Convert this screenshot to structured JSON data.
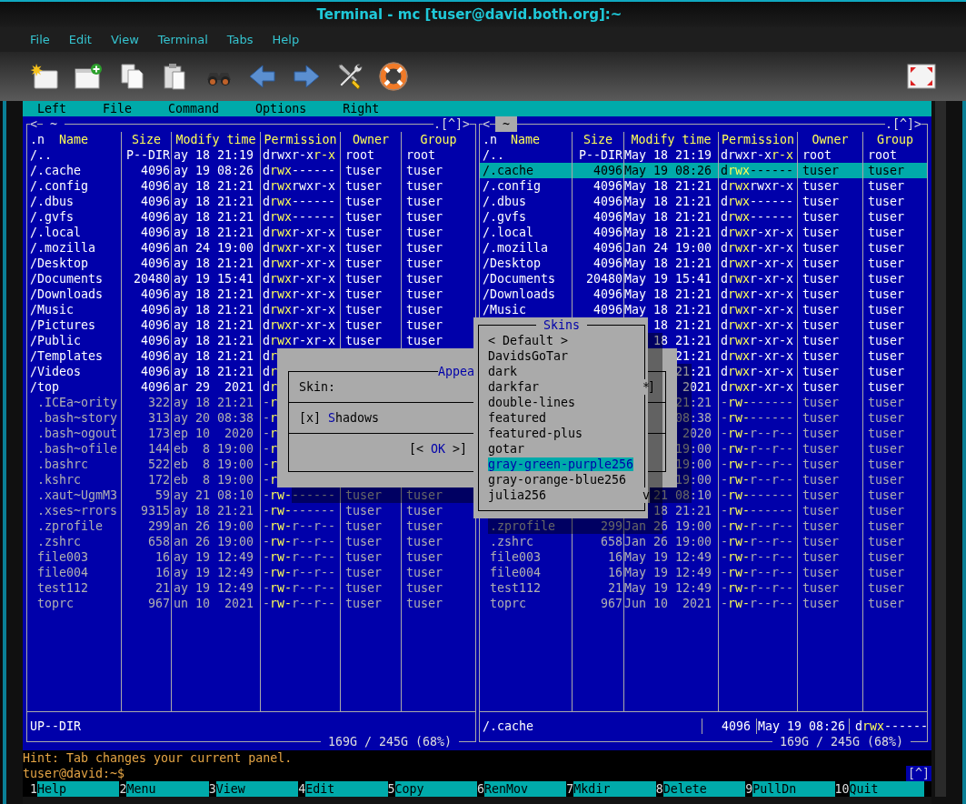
{
  "window": {
    "title": "Terminal - mc [tuser@david.both.org]:~"
  },
  "menu": [
    "File",
    "Edit",
    "View",
    "Terminal",
    "Tabs",
    "Help"
  ],
  "mc_menu": [
    "Left",
    "File",
    "Command",
    "Options",
    "Right"
  ],
  "panels": [
    {
      "history": "<",
      "path": "~",
      "path_selected": false,
      "hotlist": ".[^]>",
      "sort_mark": ".n",
      "columns": [
        "Name",
        "Size",
        "Modify time",
        "Permission",
        "Owner",
        "Group"
      ],
      "rows": [
        {
          "kind": "dir",
          "name": "/..",
          "size": "P--DIR",
          "modified": "ay 18 21:19",
          "permission": "drwxr-xr-x",
          "is_owner": false,
          "owner": "root",
          "group": "root",
          "selected": false
        },
        {
          "kind": "dir",
          "name": "/.cache",
          "size": "4096",
          "modified": "ay 19 08:26",
          "permission": "drwx------",
          "is_owner": true,
          "owner": "tuser",
          "group": "tuser",
          "selected": false
        },
        {
          "kind": "dir",
          "name": "/.config",
          "size": "4096",
          "modified": "ay 18 21:21",
          "permission": "drwxrwxr-x",
          "is_owner": true,
          "owner": "tuser",
          "group": "tuser",
          "selected": false
        },
        {
          "kind": "dir",
          "name": "/.dbus",
          "size": "4096",
          "modified": "ay 18 21:21",
          "permission": "drwx------",
          "is_owner": true,
          "owner": "tuser",
          "group": "tuser",
          "selected": false
        },
        {
          "kind": "dir",
          "name": "/.gvfs",
          "size": "4096",
          "modified": "ay 18 21:21",
          "permission": "drwx------",
          "is_owner": true,
          "owner": "tuser",
          "group": "tuser",
          "selected": false
        },
        {
          "kind": "dir",
          "name": "/.local",
          "size": "4096",
          "modified": "ay 18 21:21",
          "permission": "drwxr-xr-x",
          "is_owner": true,
          "owner": "tuser",
          "group": "tuser",
          "selected": false
        },
        {
          "kind": "dir",
          "name": "/.mozilla",
          "size": "4096",
          "modified": "an 24 19:00",
          "permission": "drwxr-xr-x",
          "is_owner": true,
          "owner": "tuser",
          "group": "tuser",
          "selected": false
        },
        {
          "kind": "dir",
          "name": "/Desktop",
          "size": "4096",
          "modified": "ay 18 21:21",
          "permission": "drwxr-xr-x",
          "is_owner": true,
          "owner": "tuser",
          "group": "tuser",
          "selected": false
        },
        {
          "kind": "dir",
          "name": "/Documents",
          "size": "20480",
          "modified": "ay 19 15:41",
          "permission": "drwxr-xr-x",
          "is_owner": true,
          "owner": "tuser",
          "group": "tuser",
          "selected": false
        },
        {
          "kind": "dir",
          "name": "/Downloads",
          "size": "4096",
          "modified": "ay 18 21:21",
          "permission": "drwxr-xr-x",
          "is_owner": true,
          "owner": "tuser",
          "group": "tuser",
          "selected": false
        },
        {
          "kind": "dir",
          "name": "/Music",
          "size": "4096",
          "modified": "ay 18 21:21",
          "permission": "drwxr-xr-x",
          "is_owner": true,
          "owner": "tuser",
          "group": "tuser",
          "selected": false
        },
        {
          "kind": "dir",
          "name": "/Pictures",
          "size": "4096",
          "modified": "ay 18 21:21",
          "permission": "drwxr-xr-x",
          "is_owner": true,
          "owner": "tuser",
          "group": "tuser",
          "selected": false
        },
        {
          "kind": "dir",
          "name": "/Public",
          "size": "4096",
          "modified": "ay 18 21:21",
          "permission": "drwxr-xr-x",
          "is_owner": true,
          "owner": "tuser",
          "group": "tuser",
          "selected": false
        },
        {
          "kind": "dir",
          "name": "/Templates",
          "size": "4096",
          "modified": "ay 18 21:21",
          "permission": "dr",
          "is_owner": true,
          "selected": false
        },
        {
          "kind": "dir",
          "name": "/Videos",
          "size": "4096",
          "modified": "ay 18 21:21",
          "permission": "dr",
          "is_owner": true,
          "selected": false
        },
        {
          "kind": "dir",
          "name": "/top",
          "size": "4096",
          "modified": "ar 29  2021",
          "permission": "dr",
          "is_owner": true,
          "selected": false
        },
        {
          "kind": "file",
          "name": ".ICEa~ority",
          "size": "322",
          "modified": "ay 18 21:21",
          "permission": "-r",
          "is_owner": true,
          "selected": false
        },
        {
          "kind": "file",
          "name": ".bash~story",
          "size": "313",
          "modified": "ay 20 08:38",
          "permission": "-r",
          "is_owner": true,
          "selected": false
        },
        {
          "kind": "file",
          "name": ".bash~ogout",
          "size": "173",
          "modified": "ep 10  2020",
          "permission": "-r",
          "is_owner": true,
          "selected": false
        },
        {
          "kind": "file",
          "name": ".bash~ofile",
          "size": "144",
          "modified": "eb  8 19:00",
          "permission": "-r",
          "is_owner": true,
          "selected": false
        },
        {
          "kind": "file",
          "name": ".bashrc",
          "size": "522",
          "modified": "eb  8 19:00",
          "permission": "-r",
          "is_owner": true,
          "selected": false
        },
        {
          "kind": "file",
          "name": ".kshrc",
          "size": "172",
          "modified": "eb  8 19:00",
          "permission": "-r",
          "is_owner": true,
          "selected": false
        },
        {
          "kind": "file",
          "name": ".xaut~UgmM3",
          "size": "59",
          "modified": "ay 21 08:10",
          "permission": "-rw-------",
          "is_owner": true,
          "owner": "tuser",
          "group": "tuser",
          "selected": false
        },
        {
          "kind": "file",
          "name": ".xses~rrors",
          "size": "9315",
          "modified": "ay 18 21:21",
          "permission": "-rw-------",
          "is_owner": true,
          "owner": "tuser",
          "group": "tuser",
          "selected": false
        },
        {
          "kind": "file",
          "name": ".zprofile",
          "size": "299",
          "modified": "an 26 19:00",
          "permission": "-rw-r--r--",
          "is_owner": true,
          "owner": "tuser",
          "group": "tuser",
          "selected": false
        },
        {
          "kind": "file",
          "name": ".zshrc",
          "size": "658",
          "modified": "an 26 19:00",
          "permission": "-rw-r--r--",
          "is_owner": true,
          "owner": "tuser",
          "group": "tuser",
          "selected": false
        },
        {
          "kind": "file",
          "name": "file003",
          "size": "16",
          "modified": "ay 19 12:49",
          "permission": "-rw-r--r--",
          "is_owner": true,
          "owner": "tuser",
          "group": "tuser",
          "selected": false
        },
        {
          "kind": "file",
          "name": "file004",
          "size": "16",
          "modified": "ay 19 12:49",
          "permission": "-rw-r--r--",
          "is_owner": true,
          "owner": "tuser",
          "group": "tuser",
          "selected": false
        },
        {
          "kind": "file",
          "name": "test112",
          "size": "21",
          "modified": "ay 19 12:49",
          "permission": "-rw-r--r--",
          "is_owner": true,
          "owner": "tuser",
          "group": "tuser",
          "selected": false
        },
        {
          "kind": "file",
          "name": "toprc",
          "size": "967",
          "modified": "un 10  2021",
          "permission": "-rw-r--r--",
          "is_owner": true,
          "owner": "tuser",
          "group": "tuser",
          "selected": false
        }
      ],
      "mini_status": {
        "name": "UP--DIR"
      },
      "disk": "169G / 245G (68%)"
    },
    {
      "history": "<",
      "path": "~",
      "path_selected": true,
      "hotlist": ".[^]>",
      "sort_mark": ".n",
      "columns": [
        "Name",
        "Size",
        "Modify time",
        "Permission",
        "Owner",
        "Group"
      ],
      "rows": [
        {
          "kind": "dir",
          "name": "/..",
          "size": "P--DIR",
          "modified": "May 18 21:19",
          "permission": "drwxr-xr-x",
          "is_owner": false,
          "owner": "root",
          "group": "root",
          "selected": false
        },
        {
          "kind": "dir",
          "name": "/.cache",
          "size": "4096",
          "modified": "May 19 08:26",
          "permission": "drwx------",
          "is_owner": true,
          "owner": "tuser",
          "group": "tuser",
          "selected": true
        },
        {
          "kind": "dir",
          "name": "/.config",
          "size": "4096",
          "modified": "May 18 21:21",
          "permission": "drwxrwxr-x",
          "is_owner": true,
          "owner": "tuser",
          "group": "tuser",
          "selected": false
        },
        {
          "kind": "dir",
          "name": "/.dbus",
          "size": "4096",
          "modified": "May 18 21:21",
          "permission": "drwx------",
          "is_owner": true,
          "owner": "tuser",
          "group": "tuser",
          "selected": false
        },
        {
          "kind": "dir",
          "name": "/.gvfs",
          "size": "4096",
          "modified": "May 18 21:21",
          "permission": "drwx------",
          "is_owner": true,
          "owner": "tuser",
          "group": "tuser",
          "selected": false
        },
        {
          "kind": "dir",
          "name": "/.local",
          "size": "4096",
          "modified": "May 18 21:21",
          "permission": "drwxr-xr-x",
          "is_owner": true,
          "owner": "tuser",
          "group": "tuser",
          "selected": false
        },
        {
          "kind": "dir",
          "name": "/.mozilla",
          "size": "4096",
          "modified": "Jan 24 19:00",
          "permission": "drwxr-xr-x",
          "is_owner": true,
          "owner": "tuser",
          "group": "tuser",
          "selected": false
        },
        {
          "kind": "dir",
          "name": "/Desktop",
          "size": "4096",
          "modified": "May 18 21:21",
          "permission": "drwxr-xr-x",
          "is_owner": true,
          "owner": "tuser",
          "group": "tuser",
          "selected": false
        },
        {
          "kind": "dir",
          "name": "/Documents",
          "size": "20480",
          "modified": "May 19 15:41",
          "permission": "drwxr-xr-x",
          "is_owner": true,
          "owner": "tuser",
          "group": "tuser",
          "selected": false
        },
        {
          "kind": "dir",
          "name": "/Downloads",
          "size": "4096",
          "modified": "May 18 21:21",
          "permission": "drwxr-xr-x",
          "is_owner": true,
          "owner": "tuser",
          "group": "tuser",
          "selected": false
        },
        {
          "kind": "dir",
          "name": "/Music",
          "size": "4096",
          "modified": "May 18 21:21",
          "permission": "drwxr-xr-x",
          "is_owner": true,
          "owner": "tuser",
          "group": "tuser",
          "selected": false
        },
        {
          "kind": "dir",
          "modified": "18 21:21",
          "permission": "drwxr-xr-x",
          "is_owner": true,
          "owner": "tuser",
          "group": "tuser",
          "selected": false
        },
        {
          "kind": "dir",
          "modified": "18 21:21",
          "permission": "drwxr-xr-x",
          "is_owner": true,
          "owner": "tuser",
          "group": "tuser",
          "selected": false
        },
        {
          "kind": "dir",
          "modified": "21:21",
          "permission": "drwxr-xr-x",
          "is_owner": true,
          "owner": "tuser",
          "group": "tuser",
          "selected": false
        },
        {
          "kind": "dir",
          "modified": "21:21",
          "permission": "drwxr-xr-x",
          "is_owner": true,
          "owner": "tuser",
          "group": "tuser",
          "selected": false
        },
        {
          "kind": "dir",
          "modified": "2021",
          "permission": "drwxr-xr-x",
          "is_owner": true,
          "owner": "tuser",
          "group": "tuser",
          "selected": false
        },
        {
          "kind": "file",
          "modified": "21:21",
          "permission": "-rw-------",
          "is_owner": true,
          "owner": "tuser",
          "group": "tuser",
          "selected": false
        },
        {
          "kind": "file",
          "modified": "08:38",
          "permission": "-rw-------",
          "is_owner": true,
          "owner": "tuser",
          "group": "tuser",
          "selected": false
        },
        {
          "kind": "file",
          "modified": "2020",
          "permission": "-rw-r--r--",
          "is_owner": true,
          "owner": "tuser",
          "group": "tuser",
          "selected": false
        },
        {
          "kind": "file",
          "modified": "19:00",
          "permission": "-rw-r--r--",
          "is_owner": true,
          "owner": "tuser",
          "group": "tuser",
          "selected": false
        },
        {
          "kind": "file",
          "modified": "19:00",
          "permission": "-rw-r--r--",
          "is_owner": true,
          "owner": "tuser",
          "group": "tuser",
          "selected": false
        },
        {
          "kind": "file",
          "modified": "19:00",
          "permission": "-rw-r--r--",
          "is_owner": true,
          "owner": "tuser",
          "group": "tuser",
          "selected": false
        },
        {
          "kind": "file",
          "modified": "21 08:10",
          "permission": "-rw-------",
          "is_owner": true,
          "owner": "tuser",
          "group": "tuser",
          "selected": false
        },
        {
          "kind": "file",
          "modified": "18 21:21",
          "permission": "-rw-------",
          "is_owner": true,
          "owner": "tuser",
          "group": "tuser",
          "selected": false
        },
        {
          "kind": "file",
          "name": ".zprofile",
          "size": "299",
          "modified": "Jan 26 19:00",
          "permission": "-rw-r--r--",
          "is_owner": true,
          "owner": "tuser",
          "group": "tuser",
          "selected": false
        },
        {
          "kind": "file",
          "name": ".zshrc",
          "size": "658",
          "modified": "Jan 26 19:00",
          "permission": "-rw-r--r--",
          "is_owner": true,
          "owner": "tuser",
          "group": "tuser",
          "selected": false
        },
        {
          "kind": "file",
          "name": "file003",
          "size": "16",
          "modified": "May 19 12:49",
          "permission": "-rw-r--r--",
          "is_owner": true,
          "owner": "tuser",
          "group": "tuser",
          "selected": false
        },
        {
          "kind": "file",
          "name": "file004",
          "size": "16",
          "modified": "May 19 12:49",
          "permission": "-rw-r--r--",
          "is_owner": true,
          "owner": "tuser",
          "group": "tuser",
          "selected": false
        },
        {
          "kind": "file",
          "name": "test112",
          "size": "21",
          "modified": "May 19 12:49",
          "permission": "-rw-r--r--",
          "is_owner": true,
          "owner": "tuser",
          "group": "tuser",
          "selected": false
        },
        {
          "kind": "file",
          "name": "toprc",
          "size": "967",
          "modified": "Jun 10  2021",
          "permission": "-rw-r--r--",
          "is_owner": true,
          "owner": "tuser",
          "group": "tuser",
          "selected": false
        }
      ],
      "mini_status": {
        "name": "/.cache",
        "size": "4096",
        "modified": "May 19 08:26",
        "permission": "drwx------",
        "is_owner": true
      },
      "disk": "169G / 245G (68%)"
    }
  ],
  "appearance_dialog": {
    "title": "Appea",
    "skin_label": "Skin:",
    "skin_button_end": "]",
    "shadows": {
      "box": "[x]",
      "checked": true,
      "hotkey": "S",
      "rest": "hadows"
    },
    "ok": {
      "left": "[<",
      "label": "OK",
      "right": ">]"
    }
  },
  "skins_popup": {
    "title": "Skins",
    "items": [
      {
        "label": "< Default >",
        "selected": false
      },
      {
        "label": "DavidsGoTar",
        "selected": false
      },
      {
        "label": "dark",
        "selected": false
      },
      {
        "label": "darkfar",
        "selected": false,
        "scroll_mark": "*"
      },
      {
        "label": "double-lines",
        "selected": false
      },
      {
        "label": "featured",
        "selected": false
      },
      {
        "label": "featured-plus",
        "selected": false
      },
      {
        "label": "gotar",
        "selected": false
      },
      {
        "label": "gray-green-purple256",
        "selected": true
      },
      {
        "label": "gray-orange-blue256",
        "selected": false
      },
      {
        "label": "julia256",
        "selected": false,
        "scroll_mark": "v"
      }
    ]
  },
  "hint": "Hint: Tab changes your current panel.",
  "prompt": "tuser@david:~$",
  "prompt_button": "[^]",
  "keybar": [
    {
      "key": "1",
      "label": "Help"
    },
    {
      "key": "2",
      "label": "Menu"
    },
    {
      "key": "3",
      "label": "View"
    },
    {
      "key": "4",
      "label": "Edit"
    },
    {
      "key": "5",
      "label": "Copy"
    },
    {
      "key": "6",
      "label": "RenMov"
    },
    {
      "key": "7",
      "label": "Mkdir"
    },
    {
      "key": "8",
      "label": "Delete"
    },
    {
      "key": "9",
      "label": "PullDn"
    },
    {
      "key": "10",
      "label": "Quit"
    }
  ]
}
